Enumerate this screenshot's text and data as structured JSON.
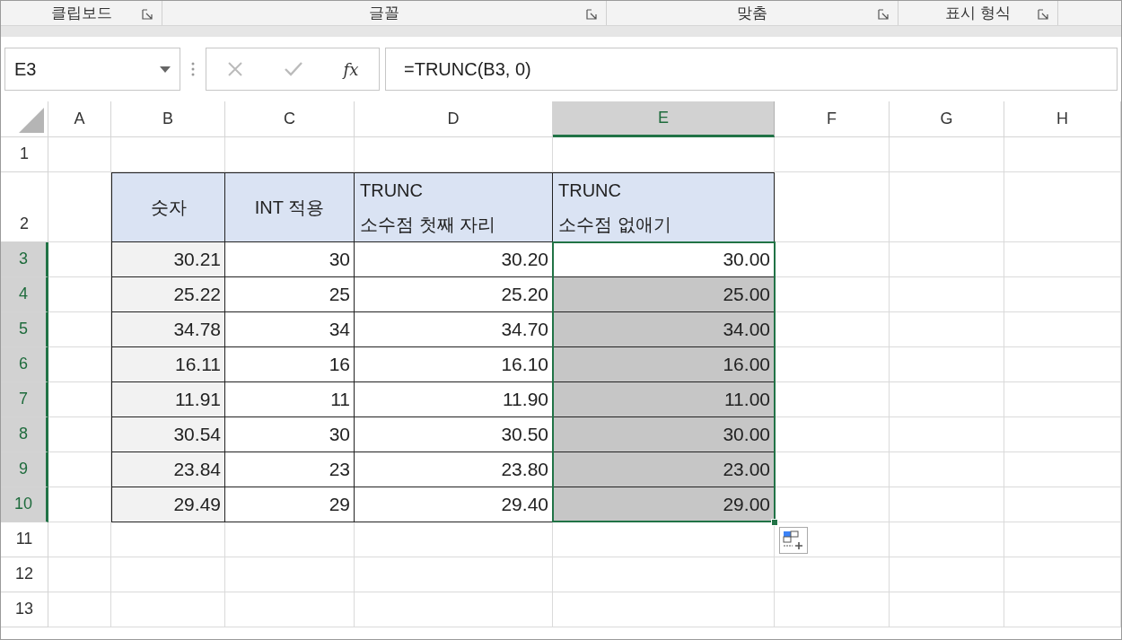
{
  "ribbon_groups": [
    {
      "label": "클립보드"
    },
    {
      "label": "글꼴"
    },
    {
      "label": "맞춤"
    },
    {
      "label": "표시 형식"
    }
  ],
  "name_box": "E3",
  "function_label": "fx",
  "formula": "=TRUNC(B3, 0)",
  "columns": [
    {
      "label": "A",
      "selected": false
    },
    {
      "label": "B",
      "selected": false
    },
    {
      "label": "C",
      "selected": false
    },
    {
      "label": "D",
      "selected": false
    },
    {
      "label": "E",
      "selected": true
    },
    {
      "label": "F",
      "selected": false
    },
    {
      "label": "G",
      "selected": false
    },
    {
      "label": "H",
      "selected": false
    }
  ],
  "row_headers": [
    {
      "label": "1",
      "selected": false
    },
    {
      "label": "2",
      "selected": false
    },
    {
      "label": "3",
      "selected": true
    },
    {
      "label": "4",
      "selected": true
    },
    {
      "label": "5",
      "selected": true
    },
    {
      "label": "6",
      "selected": true
    },
    {
      "label": "7",
      "selected": true
    },
    {
      "label": "8",
      "selected": true
    },
    {
      "label": "9",
      "selected": true
    },
    {
      "label": "10",
      "selected": true
    },
    {
      "label": "11",
      "selected": false
    },
    {
      "label": "12",
      "selected": false
    },
    {
      "label": "13",
      "selected": false
    }
  ],
  "table": {
    "headers": [
      "숫자",
      "INT 적용",
      "TRUNC\n소수점 첫째 자리",
      "TRUNC\n소수점 없애기"
    ],
    "rows": [
      {
        "values": [
          "30.21",
          "30",
          "30.20",
          "30.00"
        ],
        "selected": true,
        "active": true
      },
      {
        "values": [
          "25.22",
          "25",
          "25.20",
          "25.00"
        ],
        "selected": true,
        "active": false
      },
      {
        "values": [
          "34.78",
          "34",
          "34.70",
          "34.00"
        ],
        "selected": true,
        "active": false
      },
      {
        "values": [
          "16.11",
          "16",
          "16.10",
          "16.00"
        ],
        "selected": true,
        "active": false
      },
      {
        "values": [
          "11.91",
          "11",
          "11.90",
          "11.00"
        ],
        "selected": true,
        "active": false
      },
      {
        "values": [
          "30.54",
          "30",
          "30.50",
          "30.00"
        ],
        "selected": true,
        "active": false
      },
      {
        "values": [
          "23.84",
          "23",
          "23.80",
          "23.00"
        ],
        "selected": true,
        "active": false
      },
      {
        "values": [
          "29.49",
          "29",
          "29.40",
          "29.00"
        ],
        "selected": true,
        "active": false
      }
    ]
  }
}
